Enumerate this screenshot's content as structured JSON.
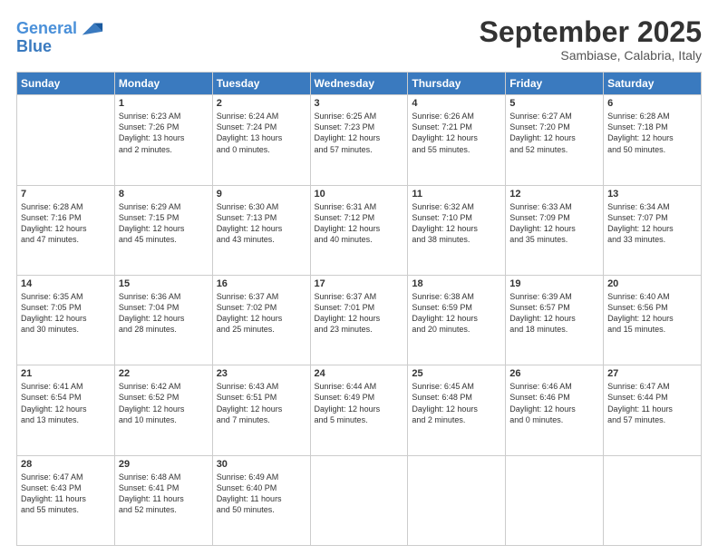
{
  "header": {
    "logo_line1": "General",
    "logo_line2": "Blue",
    "month_title": "September 2025",
    "subtitle": "Sambiase, Calabria, Italy"
  },
  "days_of_week": [
    "Sunday",
    "Monday",
    "Tuesday",
    "Wednesday",
    "Thursday",
    "Friday",
    "Saturday"
  ],
  "weeks": [
    [
      {
        "day": "",
        "info": ""
      },
      {
        "day": "1",
        "info": "Sunrise: 6:23 AM\nSunset: 7:26 PM\nDaylight: 13 hours\nand 2 minutes."
      },
      {
        "day": "2",
        "info": "Sunrise: 6:24 AM\nSunset: 7:24 PM\nDaylight: 13 hours\nand 0 minutes."
      },
      {
        "day": "3",
        "info": "Sunrise: 6:25 AM\nSunset: 7:23 PM\nDaylight: 12 hours\nand 57 minutes."
      },
      {
        "day": "4",
        "info": "Sunrise: 6:26 AM\nSunset: 7:21 PM\nDaylight: 12 hours\nand 55 minutes."
      },
      {
        "day": "5",
        "info": "Sunrise: 6:27 AM\nSunset: 7:20 PM\nDaylight: 12 hours\nand 52 minutes."
      },
      {
        "day": "6",
        "info": "Sunrise: 6:28 AM\nSunset: 7:18 PM\nDaylight: 12 hours\nand 50 minutes."
      }
    ],
    [
      {
        "day": "7",
        "info": "Sunrise: 6:28 AM\nSunset: 7:16 PM\nDaylight: 12 hours\nand 47 minutes."
      },
      {
        "day": "8",
        "info": "Sunrise: 6:29 AM\nSunset: 7:15 PM\nDaylight: 12 hours\nand 45 minutes."
      },
      {
        "day": "9",
        "info": "Sunrise: 6:30 AM\nSunset: 7:13 PM\nDaylight: 12 hours\nand 43 minutes."
      },
      {
        "day": "10",
        "info": "Sunrise: 6:31 AM\nSunset: 7:12 PM\nDaylight: 12 hours\nand 40 minutes."
      },
      {
        "day": "11",
        "info": "Sunrise: 6:32 AM\nSunset: 7:10 PM\nDaylight: 12 hours\nand 38 minutes."
      },
      {
        "day": "12",
        "info": "Sunrise: 6:33 AM\nSunset: 7:09 PM\nDaylight: 12 hours\nand 35 minutes."
      },
      {
        "day": "13",
        "info": "Sunrise: 6:34 AM\nSunset: 7:07 PM\nDaylight: 12 hours\nand 33 minutes."
      }
    ],
    [
      {
        "day": "14",
        "info": "Sunrise: 6:35 AM\nSunset: 7:05 PM\nDaylight: 12 hours\nand 30 minutes."
      },
      {
        "day": "15",
        "info": "Sunrise: 6:36 AM\nSunset: 7:04 PM\nDaylight: 12 hours\nand 28 minutes."
      },
      {
        "day": "16",
        "info": "Sunrise: 6:37 AM\nSunset: 7:02 PM\nDaylight: 12 hours\nand 25 minutes."
      },
      {
        "day": "17",
        "info": "Sunrise: 6:37 AM\nSunset: 7:01 PM\nDaylight: 12 hours\nand 23 minutes."
      },
      {
        "day": "18",
        "info": "Sunrise: 6:38 AM\nSunset: 6:59 PM\nDaylight: 12 hours\nand 20 minutes."
      },
      {
        "day": "19",
        "info": "Sunrise: 6:39 AM\nSunset: 6:57 PM\nDaylight: 12 hours\nand 18 minutes."
      },
      {
        "day": "20",
        "info": "Sunrise: 6:40 AM\nSunset: 6:56 PM\nDaylight: 12 hours\nand 15 minutes."
      }
    ],
    [
      {
        "day": "21",
        "info": "Sunrise: 6:41 AM\nSunset: 6:54 PM\nDaylight: 12 hours\nand 13 minutes."
      },
      {
        "day": "22",
        "info": "Sunrise: 6:42 AM\nSunset: 6:52 PM\nDaylight: 12 hours\nand 10 minutes."
      },
      {
        "day": "23",
        "info": "Sunrise: 6:43 AM\nSunset: 6:51 PM\nDaylight: 12 hours\nand 7 minutes."
      },
      {
        "day": "24",
        "info": "Sunrise: 6:44 AM\nSunset: 6:49 PM\nDaylight: 12 hours\nand 5 minutes."
      },
      {
        "day": "25",
        "info": "Sunrise: 6:45 AM\nSunset: 6:48 PM\nDaylight: 12 hours\nand 2 minutes."
      },
      {
        "day": "26",
        "info": "Sunrise: 6:46 AM\nSunset: 6:46 PM\nDaylight: 12 hours\nand 0 minutes."
      },
      {
        "day": "27",
        "info": "Sunrise: 6:47 AM\nSunset: 6:44 PM\nDaylight: 11 hours\nand 57 minutes."
      }
    ],
    [
      {
        "day": "28",
        "info": "Sunrise: 6:47 AM\nSunset: 6:43 PM\nDaylight: 11 hours\nand 55 minutes."
      },
      {
        "day": "29",
        "info": "Sunrise: 6:48 AM\nSunset: 6:41 PM\nDaylight: 11 hours\nand 52 minutes."
      },
      {
        "day": "30",
        "info": "Sunrise: 6:49 AM\nSunset: 6:40 PM\nDaylight: 11 hours\nand 50 minutes."
      },
      {
        "day": "",
        "info": ""
      },
      {
        "day": "",
        "info": ""
      },
      {
        "day": "",
        "info": ""
      },
      {
        "day": "",
        "info": ""
      }
    ]
  ]
}
